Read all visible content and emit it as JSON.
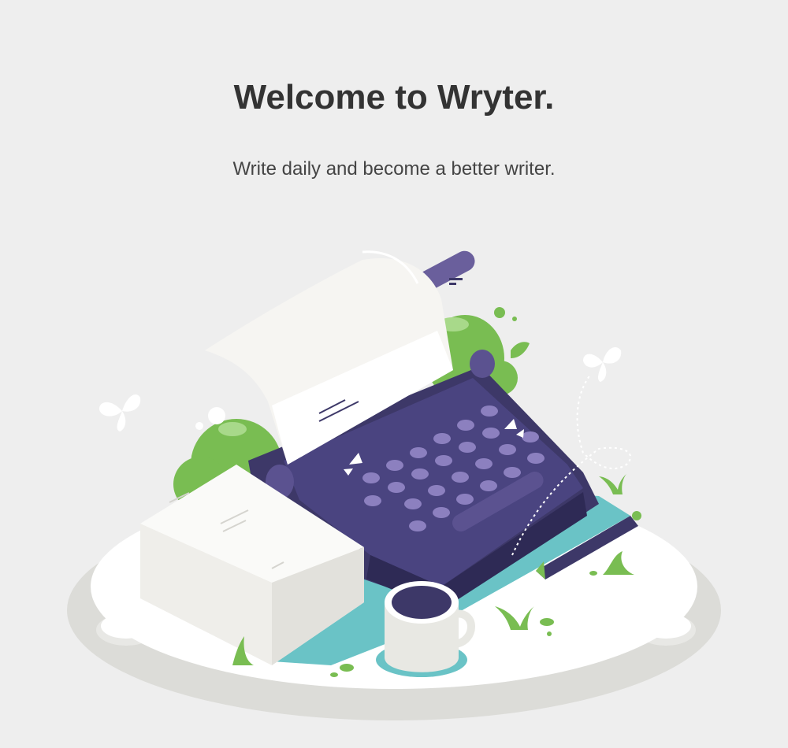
{
  "header": {
    "title": "Welcome to Wryter.",
    "subtitle": "Write daily and become a better writer."
  },
  "illustration": {
    "icon": "typewriter-illustration",
    "colors": {
      "background": "#eeeeee",
      "platform": "#ffffff",
      "platform_shadow": "#dcdcd8",
      "typewriter": "#3d3868",
      "typewriter_light": "#6a5f9c",
      "keys": "#8c80bf",
      "foliage": "#79bd52",
      "teal": "#6ac3c6",
      "paper": "#f6f5f2"
    }
  }
}
